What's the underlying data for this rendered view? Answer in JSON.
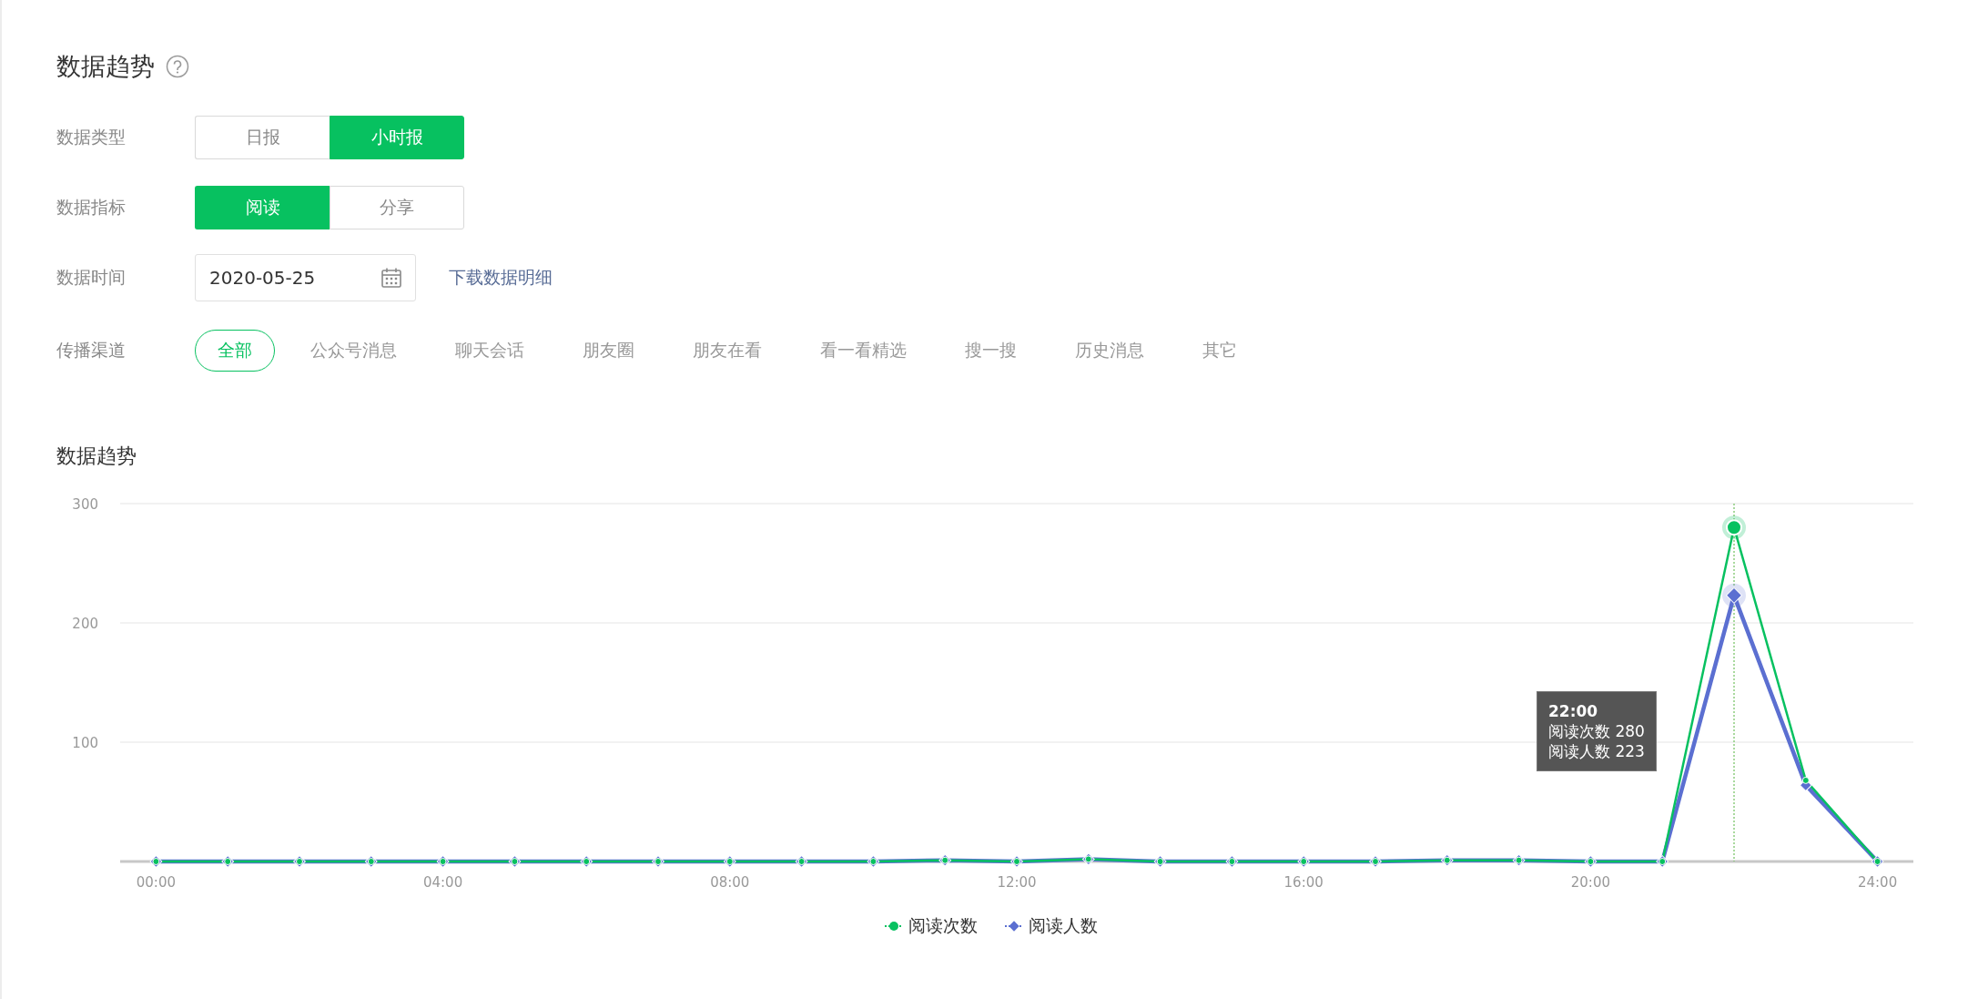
{
  "title": "数据趋势",
  "filters": [
    {
      "kind": "segmented",
      "label": "数据类型",
      "options": [
        {
          "label": "日报",
          "selected": false
        },
        {
          "label": "小时报",
          "selected": true
        }
      ]
    },
    {
      "kind": "segmented",
      "label": "数据指标",
      "options": [
        {
          "label": "阅读",
          "selected": true
        },
        {
          "label": "分享",
          "selected": false
        }
      ]
    },
    {
      "kind": "date",
      "label": "数据时间",
      "value": "2020-05-25",
      "link": "下载数据明细"
    },
    {
      "kind": "channels",
      "label": "传播渠道",
      "options": [
        {
          "label": "全部",
          "selected": true
        },
        {
          "label": "公众号消息",
          "selected": false
        },
        {
          "label": "聊天会话",
          "selected": false
        },
        {
          "label": "朋友圈",
          "selected": false
        },
        {
          "label": "朋友在看",
          "selected": false
        },
        {
          "label": "看一看精选",
          "selected": false
        },
        {
          "label": "搜一搜",
          "selected": false
        },
        {
          "label": "历史消息",
          "selected": false
        },
        {
          "label": "其它",
          "selected": false
        }
      ]
    }
  ],
  "chart_title": "数据趋势",
  "chart_data": {
    "type": "line",
    "x": [
      0,
      1,
      2,
      3,
      4,
      5,
      6,
      7,
      8,
      9,
      10,
      11,
      12,
      13,
      14,
      15,
      16,
      17,
      18,
      19,
      20,
      21,
      22,
      23,
      24
    ],
    "series": [
      {
        "name": "阅读次数",
        "color": "#07c160",
        "marker": "circle",
        "values": [
          0,
          0,
          0,
          0,
          0,
          0,
          0,
          0,
          0,
          0,
          0,
          1,
          0,
          2,
          0,
          0,
          0,
          0,
          1,
          1,
          0,
          0,
          280,
          68,
          0
        ]
      },
      {
        "name": "阅读人数",
        "color": "#5b6fd1",
        "marker": "diamond",
        "values": [
          0,
          0,
          0,
          0,
          0,
          0,
          0,
          0,
          0,
          0,
          0,
          1,
          0,
          2,
          0,
          0,
          0,
          0,
          1,
          1,
          0,
          0,
          223,
          64,
          0
        ]
      }
    ],
    "xlim": [
      -0.5,
      24.5
    ],
    "ylim": [
      0,
      300
    ],
    "xticks": [
      {
        "value": 0,
        "label": "00:00"
      },
      {
        "value": 4,
        "label": "04:00"
      },
      {
        "value": 8,
        "label": "08:00"
      },
      {
        "value": 12,
        "label": "12:00"
      },
      {
        "value": 16,
        "label": "16:00"
      },
      {
        "value": 20,
        "label": "20:00"
      },
      {
        "value": 24,
        "label": "24:00"
      }
    ],
    "yticks": [
      {
        "value": 100,
        "label": "100"
      },
      {
        "value": 200,
        "label": "200"
      },
      {
        "value": 300,
        "label": "300"
      }
    ],
    "ref_lines": [
      {
        "axis": "x",
        "value": 22
      }
    ]
  },
  "tooltip": {
    "title": "22:00",
    "lines": [
      "阅读次数 280",
      "阅读人数 223"
    ]
  }
}
